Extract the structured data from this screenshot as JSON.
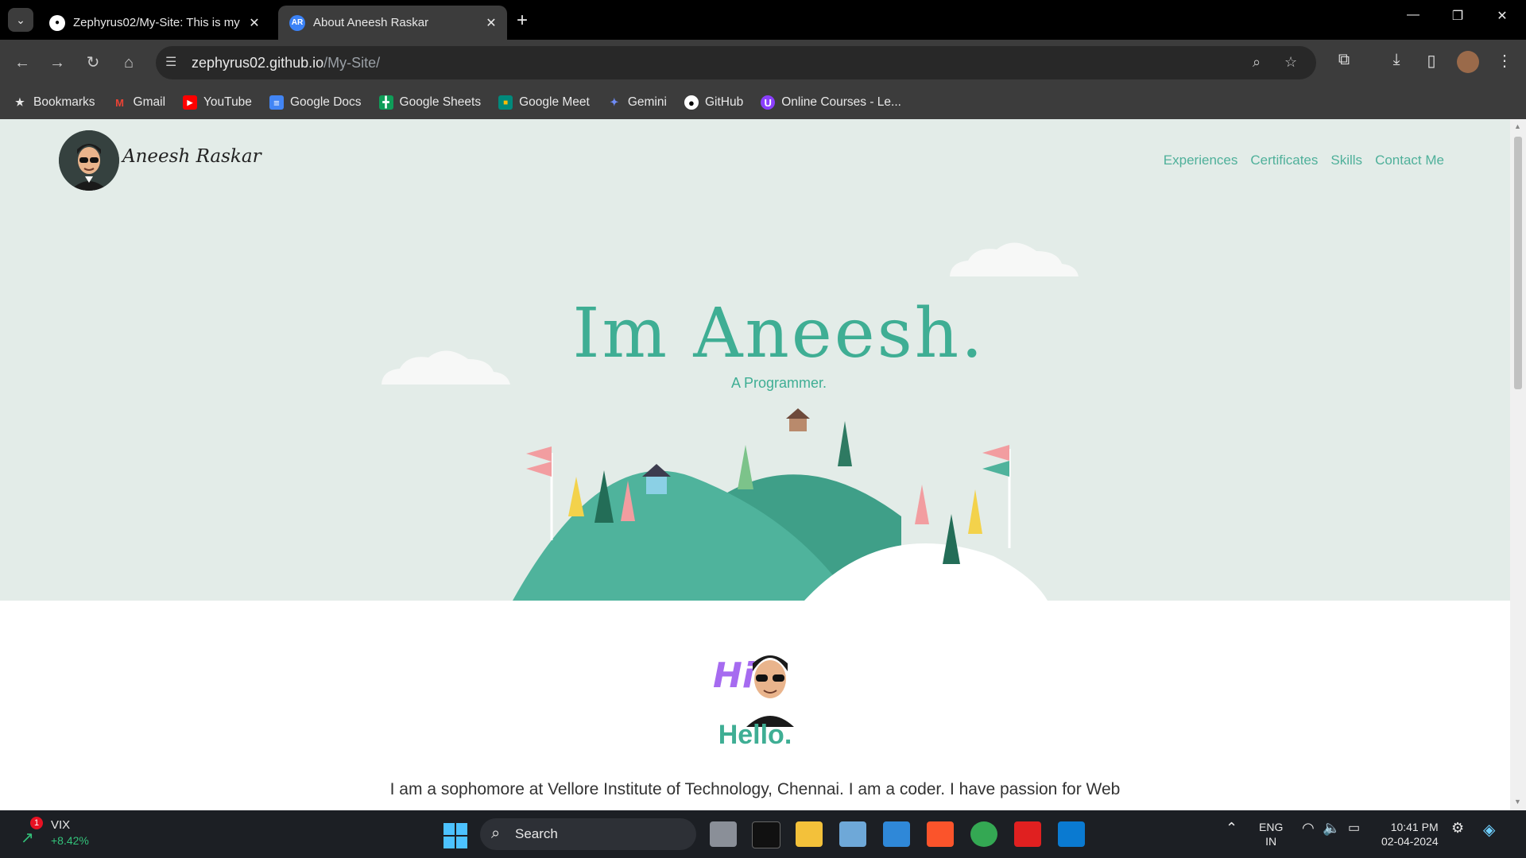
{
  "browser": {
    "tabs": [
      {
        "title": "Zephyrus02/My-Site: This is my",
        "active": false
      },
      {
        "title": "About Aneesh Raskar",
        "active": true
      }
    ],
    "url_host": "zephyrus02.github.io",
    "url_path": "/My-Site/",
    "bookmarks": [
      "Bookmarks",
      "Gmail",
      "YouTube",
      "Google Docs",
      "Google Sheets",
      "Google Meet",
      "Gemini",
      "GitHub",
      "Online Courses - Le..."
    ]
  },
  "site": {
    "brand": "Aneesh Raskar",
    "nav": [
      "Experiences",
      "Certificates",
      "Skills",
      "Contact Me"
    ],
    "hero_title": "Im Aneesh.",
    "hero_subtitle": "A Programmer.",
    "hello_title": "Hello.",
    "intro_text": "I am a sophomore at Vellore Institute of Technology, Chennai. I am a coder. I have passion for Web",
    "accent_color": "#3fae94"
  },
  "taskbar": {
    "widget_name": "VIX",
    "widget_change": "+8.42%",
    "widget_badge": "1",
    "search_label": "Search",
    "lang_line1": "ENG",
    "lang_line2": "IN",
    "time": "10:41 PM",
    "date": "02-04-2024"
  }
}
